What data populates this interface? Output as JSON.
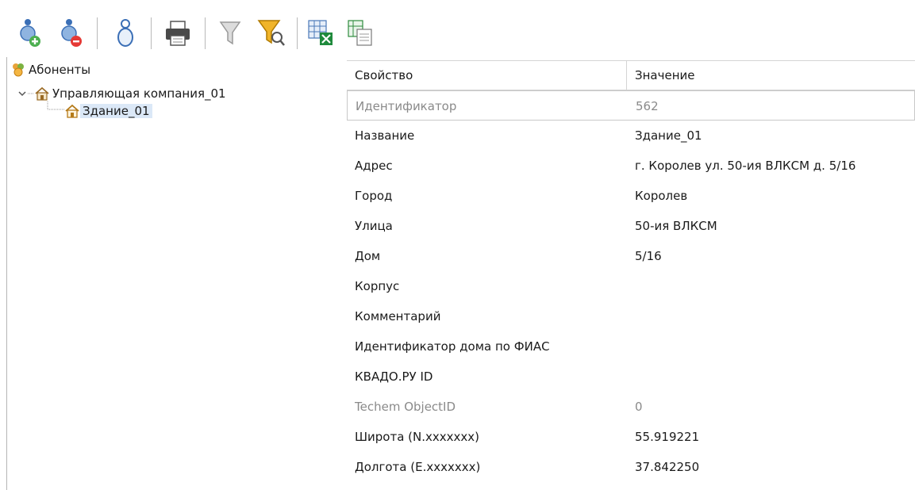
{
  "toolbar": {
    "buttons": [
      {
        "name": "add-subscriber-button",
        "icon": "person-add-icon"
      },
      {
        "name": "remove-subscriber-button",
        "icon": "person-remove-icon"
      },
      {
        "name": "subscriber-properties-button",
        "icon": "person-outline-icon"
      },
      {
        "name": "print-button",
        "icon": "printer-icon"
      },
      {
        "name": "filter-button",
        "icon": "funnel-icon"
      },
      {
        "name": "filter-search-button",
        "icon": "funnel-search-icon"
      },
      {
        "name": "export-excel-button",
        "icon": "excel-export-icon"
      },
      {
        "name": "export-document-button",
        "icon": "document-export-icon"
      }
    ]
  },
  "tree": {
    "root": {
      "label": "Абоненты",
      "icon": "subscribers-icon"
    },
    "company": {
      "label": "Управляющая компания_01",
      "icon": "company-house-icon"
    },
    "building": {
      "label": "Здание_01",
      "icon": "house-icon"
    }
  },
  "grid": {
    "headers": {
      "property": "Свойство",
      "value": "Значение"
    },
    "rows": [
      {
        "property": "Идентификатор",
        "value": "562",
        "muted": true
      },
      {
        "property": "Название",
        "value": "Здание_01",
        "muted": false
      },
      {
        "property": "Адрес",
        "value": "г. Королев ул. 50-ия ВЛКСМ д. 5/16",
        "muted": false
      },
      {
        "property": "Город",
        "value": "Королев",
        "muted": false
      },
      {
        "property": "Улица",
        "value": "50-ия ВЛКСМ",
        "muted": false
      },
      {
        "property": "Дом",
        "value": "5/16",
        "muted": false
      },
      {
        "property": "Корпус",
        "value": "",
        "muted": false
      },
      {
        "property": "Комментарий",
        "value": "",
        "muted": false
      },
      {
        "property": "Идентификатор дома по ФИАС",
        "value": "",
        "muted": false
      },
      {
        "property": "КВАДО.РУ ID",
        "value": "",
        "muted": false
      },
      {
        "property": "Techem ObjectID",
        "value": "0",
        "muted": true
      },
      {
        "property": "Широта (N.xxxxxxx)",
        "value": "55.919221",
        "muted": false
      },
      {
        "property": "Долгота (E.xxxxxxx)",
        "value": "37.842250",
        "muted": false
      }
    ]
  },
  "colors": {
    "selection": "#dbe8f7",
    "muted_text": "#8a8a8a",
    "grid_border": "#d4d4d4"
  }
}
